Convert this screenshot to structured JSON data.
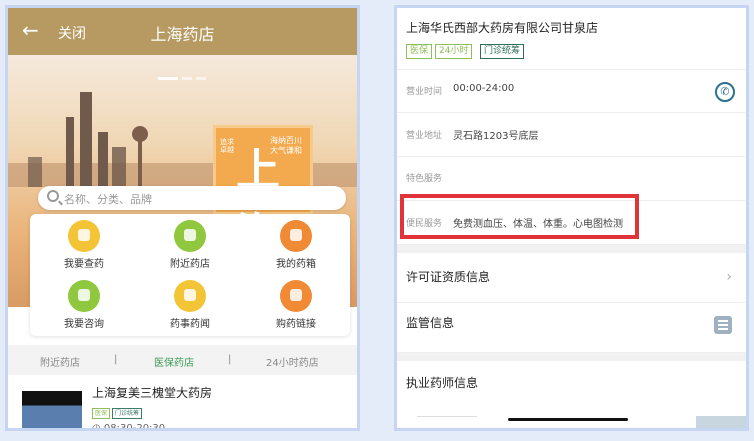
{
  "left": {
    "header": {
      "back_glyph": "←",
      "close_label": "关闭",
      "title": "上海药店"
    },
    "banner": {
      "sign_big": "上海",
      "sign_text_right": "海纳百川 大气谦和",
      "sign_text_left": "追求卓越"
    },
    "search": {
      "placeholder": "名称、分类、品牌"
    },
    "grid": [
      {
        "label": "我要查药",
        "color": "#f3c436"
      },
      {
        "label": "附近药店",
        "color": "#8fc73e"
      },
      {
        "label": "我的药箱",
        "color": "#f08a35"
      },
      {
        "label": "我要咨询",
        "color": "#8fc73e"
      },
      {
        "label": "药事药闻",
        "color": "#f3c436"
      },
      {
        "label": "购药链接",
        "color": "#f08a35"
      }
    ],
    "tabs": {
      "items": [
        "附近药店",
        "医保药店",
        "24小时药店"
      ],
      "separator": "|",
      "active_color": "#3d9a54"
    },
    "pharmacy": {
      "name": "上海复美三槐堂大药房",
      "tags": [
        "医保",
        "门诊统筹"
      ],
      "hours": "08:30-20:30"
    }
  },
  "right": {
    "name": "上海华氏西部大药房有限公司甘泉店",
    "tags": [
      "医保",
      "24小时",
      "门诊统筹"
    ],
    "rows": {
      "hours": {
        "key": "营业时间",
        "value": "00:00-24:00"
      },
      "address": {
        "key": "营业地址",
        "value": "灵石路1203号底层"
      },
      "special": {
        "key": "特色服务",
        "value": ""
      },
      "convenience": {
        "key": "便民服务",
        "value": "免费测血压、体温、体重。心电图检测"
      }
    },
    "sections": {
      "license": "许可证资质信息",
      "supervision": "监管信息",
      "pharmacist": "执业药师信息"
    },
    "highlight_color": "#e0333a"
  }
}
